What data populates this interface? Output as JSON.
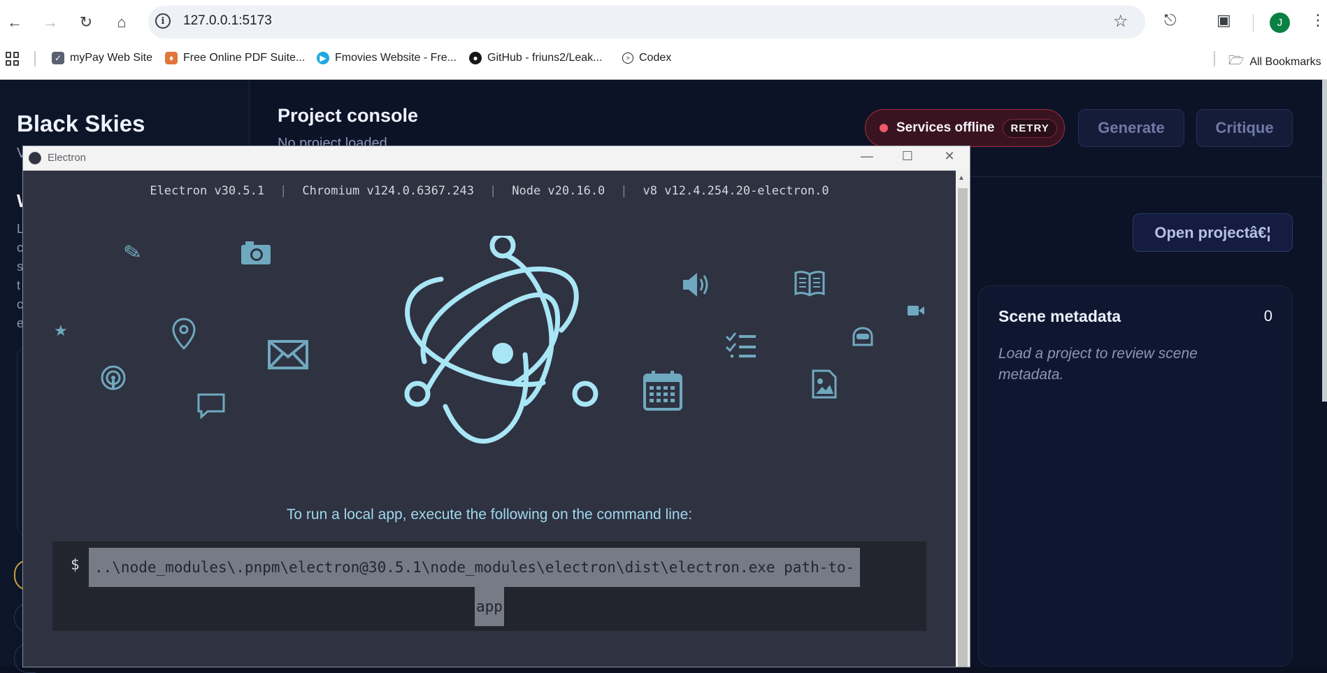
{
  "browser": {
    "url": "127.0.0.1:5173",
    "avatar_initial": "J",
    "bookmarks": [
      {
        "label": "myPay Web Site",
        "icon": "mypay-icon",
        "color": "#5b6170"
      },
      {
        "label": "Free Online PDF Suite...",
        "icon": "pdf-suite-icon",
        "color": "#e0763a"
      },
      {
        "label": "Fmovies Website - Fre...",
        "icon": "fmovies-icon",
        "color": "#21a7e0"
      },
      {
        "label": "GitHub - friuns2/Leak...",
        "icon": "github-icon",
        "color": "#181717"
      },
      {
        "label": "Codex",
        "icon": "codex-icon",
        "color": "#202124"
      }
    ],
    "all_bookmarks": "All Bookmarks"
  },
  "app": {
    "brand": "Black Skies",
    "brand_sub": "V",
    "side_heading": "W",
    "side_lines": [
      "L",
      "c",
      "s",
      "t",
      "c",
      "e"
    ],
    "header": {
      "title": "Project console",
      "subtitle": "No project loaded",
      "status_text": "Services offline",
      "retry_label": "RETRY",
      "generate_label": "Generate",
      "critique_label": "Critique"
    },
    "open_project_label": "Open projectâ€¦",
    "scene_metadata": {
      "title": "Scene metadata",
      "count": "0",
      "empty_text": "Load a project to review scene metadata."
    }
  },
  "electron_window": {
    "title": "Electron",
    "versions": [
      "Electron v30.5.1",
      "Chromium v124.0.6367.243",
      "Node v20.16.0",
      "v8 v12.4.254.20-electron.0"
    ],
    "hint": "To run a local app, execute the following on the command line:",
    "prompt": "$",
    "command_line1": "..\\node_modules\\.pnpm\\electron@30.5.1\\node_modules\\electron\\dist\\electron.exe path-to-",
    "command_line2": "app"
  },
  "colors": {
    "accent_icon": "#6fa9bf",
    "logo": "#a9e6f5",
    "status_red": "#f05a6a",
    "app_bg": "#0c1326"
  }
}
